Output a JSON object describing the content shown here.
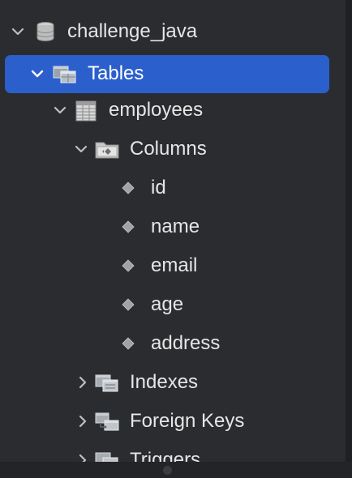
{
  "tree": {
    "database": {
      "label": "challenge_java",
      "icon": "database-icon"
    },
    "tables": {
      "label": "Tables",
      "icon": "tables-folder-icon",
      "selected": true
    },
    "table": {
      "label": "employees",
      "icon": "table-grid-icon"
    },
    "columns": {
      "label": "Columns",
      "icon": "columns-folder-icon",
      "items": [
        {
          "label": "id"
        },
        {
          "label": "name"
        },
        {
          "label": "email"
        },
        {
          "label": "age"
        },
        {
          "label": "address"
        }
      ]
    },
    "indexes": {
      "label": "Indexes",
      "icon": "indexes-folder-icon"
    },
    "foreign_keys": {
      "label": "Foreign Keys",
      "icon": "foreign-keys-icon"
    },
    "triggers": {
      "label": "Triggers",
      "icon": "triggers-folder-icon"
    }
  },
  "colors": {
    "background": "#2b2c2f",
    "selection": "#2b5fcc",
    "text": "#e6e6e6"
  }
}
